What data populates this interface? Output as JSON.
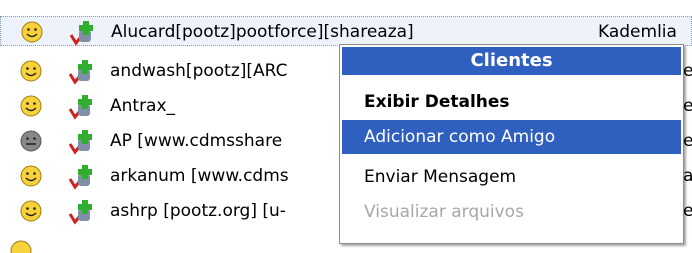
{
  "users": [
    {
      "name": "Alucard[pootz]pootforce][shareaza]",
      "network": "Kademlia",
      "status": "online"
    },
    {
      "name": "andwash[pootz][ARC",
      "edge": "e",
      "status": "online"
    },
    {
      "name": "Antrax_",
      "edge": "e",
      "status": "online"
    },
    {
      "name": "AP [www.cdmsshare",
      "edge": "e",
      "status": "away"
    },
    {
      "name": "arkanum [www.cdms",
      "edge": "a",
      "status": "online"
    },
    {
      "name": "ashrp [pootz.org] [u-",
      "edge": "e",
      "status": "online"
    }
  ],
  "context_menu": {
    "header": "Clientes",
    "items": [
      {
        "label": "Exibir Detalhes",
        "style": "bold"
      },
      {
        "label": "Adicionar como Amigo",
        "style": "highlighted"
      },
      {
        "label": "Enviar Mensagem",
        "style": "normal"
      },
      {
        "label": "Visualizar arquivos",
        "style": "disabled"
      }
    ]
  },
  "colors": {
    "menu_highlight": "#2f5fbf",
    "smiley_online": "#f7d23a",
    "smiley_away": "#888888",
    "add_user_plus": "#2fae2f",
    "check_mark": "#d02020"
  },
  "icons": {
    "status": "smiley-face-icon",
    "add": "add-user-icon"
  }
}
